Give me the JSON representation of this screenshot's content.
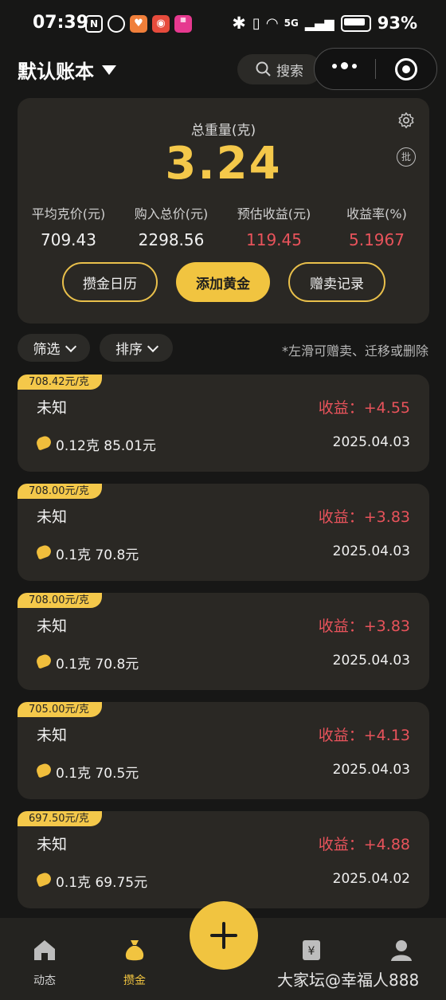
{
  "status_bar": {
    "time": "07:39",
    "network": "5G",
    "battery": "93%"
  },
  "header": {
    "account_title": "默认账本",
    "search_label": "搜索"
  },
  "summary": {
    "weight_label": "总重量(克)",
    "weight_value": "3.24",
    "pi_badge": "批",
    "stats": [
      {
        "label": "平均克价(元)",
        "value": "709.43"
      },
      {
        "label": "购入总价(元)",
        "value": "2298.56"
      },
      {
        "label": "预估收益(元)",
        "value": "119.45"
      },
      {
        "label": "收益率(%)",
        "value": "5.1967"
      }
    ],
    "buttons": {
      "calendar": "攒金日历",
      "add_gold": "添加黄金",
      "records": "赠卖记录"
    }
  },
  "filters": {
    "filter_label": "筛选",
    "sort_label": "排序",
    "hint": "*左滑可赠卖、迁移或删除"
  },
  "records": [
    {
      "price_tag": "708.42元/克",
      "name": "未知",
      "gain": "收益：+4.55",
      "amount": "0.12克 85.01元",
      "date": "2025.04.03"
    },
    {
      "price_tag": "708.00元/克",
      "name": "未知",
      "gain": "收益：+3.83",
      "amount": "0.1克 70.8元",
      "date": "2025.04.03"
    },
    {
      "price_tag": "708.00元/克",
      "name": "未知",
      "gain": "收益：+3.83",
      "amount": "0.1克 70.8元",
      "date": "2025.04.03"
    },
    {
      "price_tag": "705.00元/克",
      "name": "未知",
      "gain": "收益：+4.13",
      "amount": "0.1克 70.5元",
      "date": "2025.04.03"
    },
    {
      "price_tag": "697.50元/克",
      "name": "未知",
      "gain": "收益：+4.88",
      "amount": "0.1克 69.75元",
      "date": "2025.04.02"
    }
  ],
  "nav": {
    "items": [
      {
        "label": "动态"
      },
      {
        "label": "攒金"
      },
      {
        "label": ""
      },
      {
        "label": ""
      }
    ]
  },
  "watermark": "大家坛@幸福人888",
  "colors": {
    "accent": "#f1c440",
    "profit": "#e8535b",
    "card": "#2a2824",
    "background": "#171716"
  }
}
